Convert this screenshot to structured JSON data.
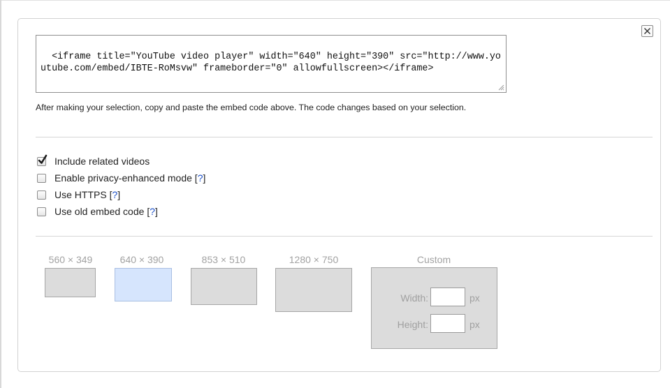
{
  "embed_code": "<iframe title=\"YouTube video player\" width=\"640\" height=\"390\" src=\"http://www.youtube.com/embed/IBTE-RoMsvw\" frameborder=\"0\" allowfullscreen></iframe>",
  "help_text": "After making your selection, copy and paste the embed code above. The code changes based on your selection.",
  "options": [
    {
      "label": "Include related videos",
      "checked": true,
      "help": ""
    },
    {
      "label": "Enable privacy-enhanced mode",
      "checked": false,
      "help": "?"
    },
    {
      "label": "Use HTTPS",
      "checked": false,
      "help": "?"
    },
    {
      "label": "Use old embed code",
      "checked": false,
      "help": "?"
    }
  ],
  "sizes": [
    {
      "label": "560 × 349",
      "selected": false
    },
    {
      "label": "640 × 390",
      "selected": true
    },
    {
      "label": "853 × 510",
      "selected": false
    },
    {
      "label": "1280 × 750",
      "selected": false
    }
  ],
  "custom": {
    "label": "Custom",
    "width_label": "Width:",
    "height_label": "Height:",
    "width_value": "",
    "height_value": "",
    "unit": "px"
  },
  "colors": {
    "link": "#1a4fc7",
    "selected_size_fill": "#d6e5fd",
    "size_fill": "#dcdcdc"
  },
  "icons": {
    "close": "close-icon",
    "check": "checkmark-icon",
    "resize": "resize-grip-icon"
  }
}
